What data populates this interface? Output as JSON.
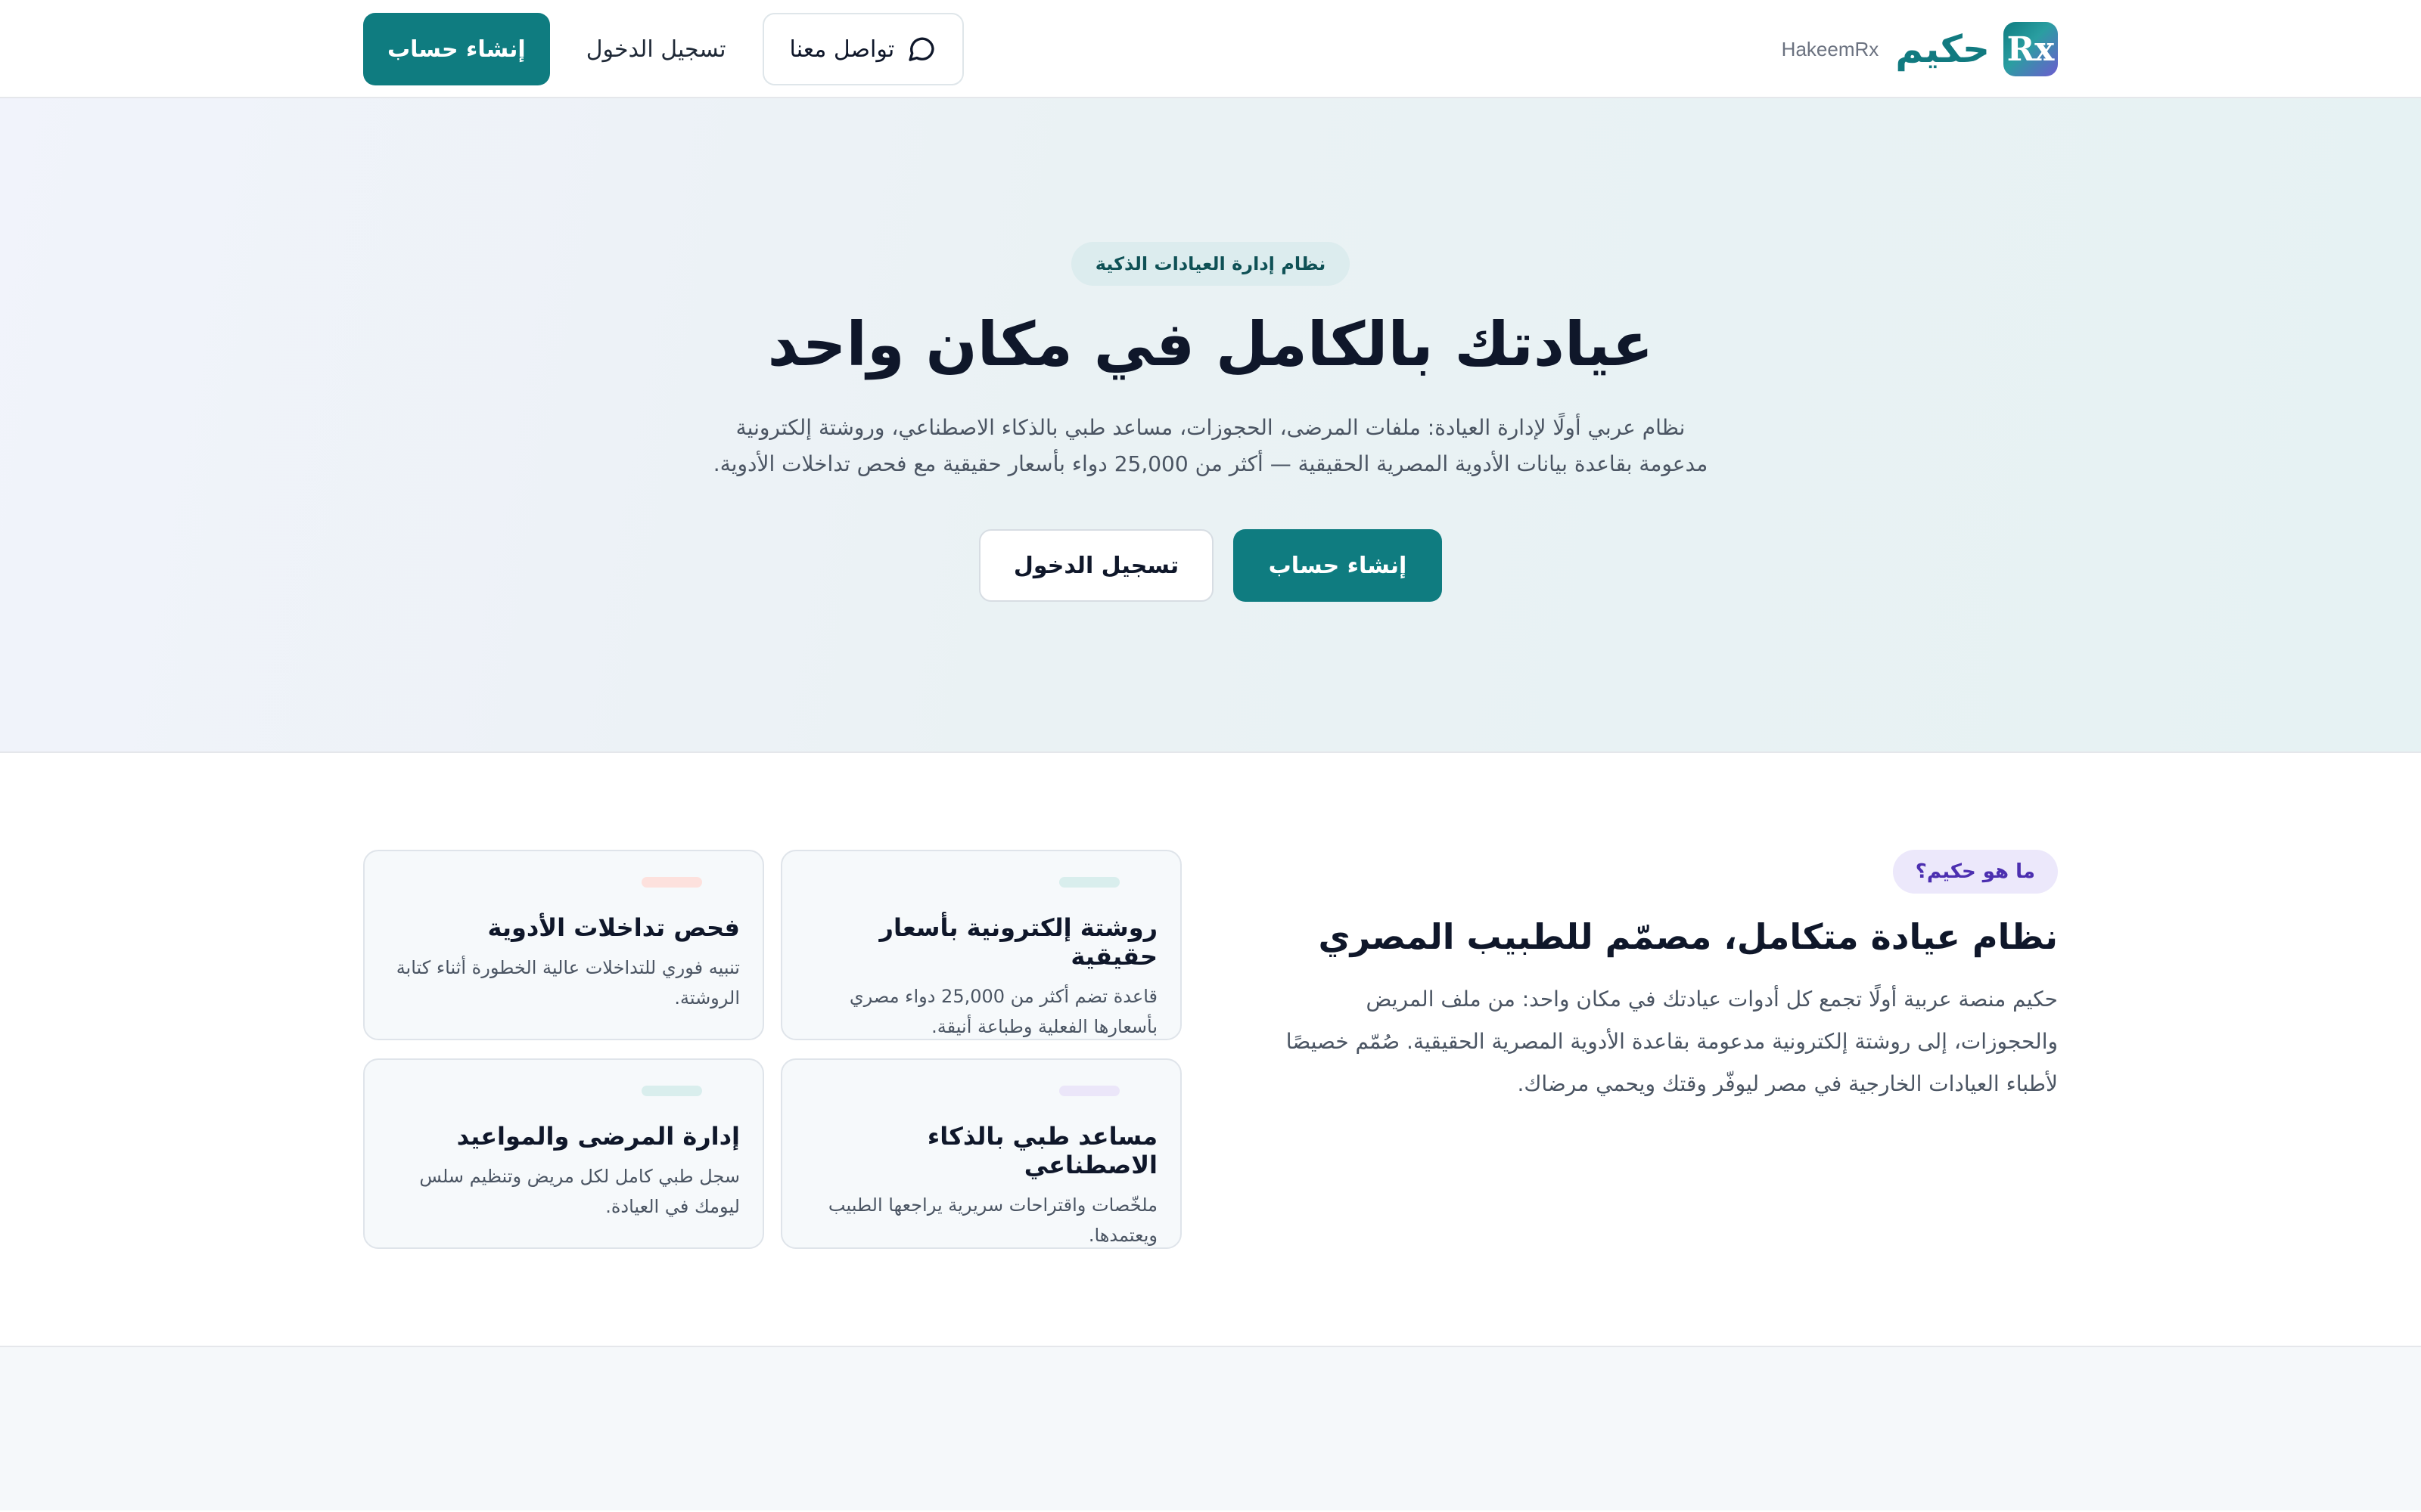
{
  "nav": {
    "brand_name": "حكيم",
    "brand_sub": "HakeemRx",
    "logo_text": "Rx",
    "contact_label": "تواصل معنا",
    "login_label": "تسجيل الدخول",
    "signup_label": "إنشاء حساب"
  },
  "hero": {
    "pill": "نظام إدارة العيادات الذكية",
    "title": "عيادتك بالكامل في مكان واحد",
    "description": "نظام عربي أولًا لإدارة العيادة: ملفات المرضى، الحجوزات، مساعد طبي بالذكاء الاصطناعي، وروشتة إلكترونية مدعومة بقاعدة بيانات الأدوية المصرية الحقيقية — أكثر من 25,000 دواء بأسعار حقيقية مع فحص تداخلات الأدوية.",
    "signup_label": "إنشاء حساب",
    "login_label": "تسجيل الدخول"
  },
  "about": {
    "pill": "ما هو حكيم؟",
    "title": "نظام عيادة متكامل، مصمّم للطبيب المصري",
    "description": "حكيم منصة عربية أولًا تجمع كل أدوات عيادتك في مكان واحد: من ملف المريض والحجوزات، إلى روشتة إلكترونية مدعومة بقاعدة الأدوية المصرية الحقيقية. صُمّم خصيصًا لأطباء العيادات الخارجية في مصر ليوفّر وقتك ويحمي مرضاك.",
    "features": [
      {
        "title": "روشتة إلكترونية بأسعار حقيقية",
        "description": "قاعدة تضم أكثر من 25,000 دواء مصري بأسعارها الفعلية وطباعة أنيقة.",
        "accent": "#d9eeed"
      },
      {
        "title": "فحص تداخلات الأدوية",
        "description": "تنبيه فوري للتداخلات عالية الخطورة أثناء كتابة الروشتة.",
        "accent": "#fde1dd"
      },
      {
        "title": "مساعد طبي بالذكاء الاصطناعي",
        "description": "ملخّصات واقتراحات سريرية يراجعها الطبيب ويعتمدها.",
        "accent": "#ebe6f9"
      },
      {
        "title": "إدارة المرضى والمواعيد",
        "description": "سجل طبي كامل لكل مريض وتنظيم سلس ليومك في العيادة.",
        "accent": "#d9eeed"
      }
    ]
  },
  "colors": {
    "primary": "#0f7c80",
    "brand_text": "#117a80",
    "about_pill_text": "#4c2fb0"
  }
}
